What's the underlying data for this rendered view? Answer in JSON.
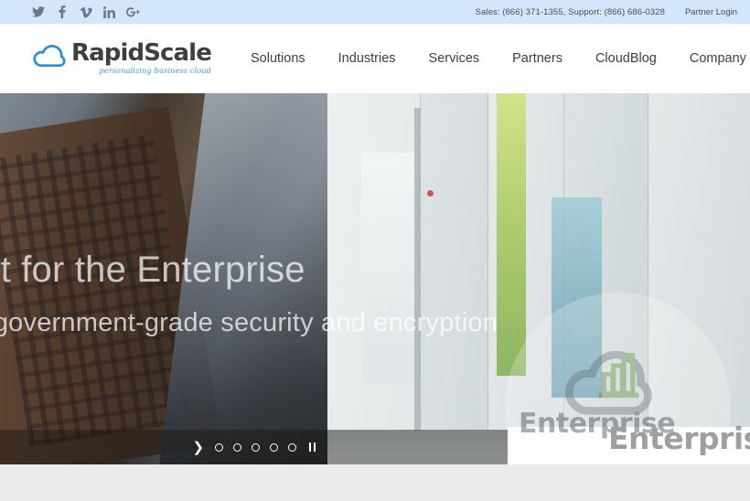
{
  "topbar": {
    "social": [
      {
        "name": "twitter-icon",
        "label": "Twitter"
      },
      {
        "name": "facebook-icon",
        "label": "Facebook"
      },
      {
        "name": "vimeo-icon",
        "label": "Vimeo"
      },
      {
        "name": "linkedin-icon",
        "label": "LinkedIn"
      },
      {
        "name": "googleplus-icon",
        "label": "Google Plus"
      }
    ],
    "contact": "Sales: (866) 371-1355, Support: (866) 686-0328",
    "partner_login": "Partner Login",
    "background_color": "#d3e6fb"
  },
  "header": {
    "logo": {
      "name": "RapidScale",
      "tagline": "personalizing business cloud",
      "cloud_color": "#2d8fd5",
      "name_color": "#3f3f3f",
      "tagline_color": "#3b9ae1"
    },
    "nav": [
      {
        "label": "Solutions"
      },
      {
        "label": "Industries"
      },
      {
        "label": "Services"
      },
      {
        "label": "Partners"
      },
      {
        "label": "CloudBlog"
      },
      {
        "label": "Company"
      }
    ],
    "search": {
      "icon": "search-icon",
      "background_color": "#d7e9fb"
    }
  },
  "hero": {
    "title": "uilt for the Enterprise",
    "subtitle": "th government-grade security and encryption",
    "watermark": {
      "brand": "Enterprise",
      "brand_overlap": "Enterprise",
      "cloud_color": "#8b9095",
      "chart_color": "#7fa85c"
    },
    "controls": {
      "next": "❯",
      "dots": [
        1,
        2,
        3,
        4,
        5
      ],
      "pause": "pause"
    }
  }
}
